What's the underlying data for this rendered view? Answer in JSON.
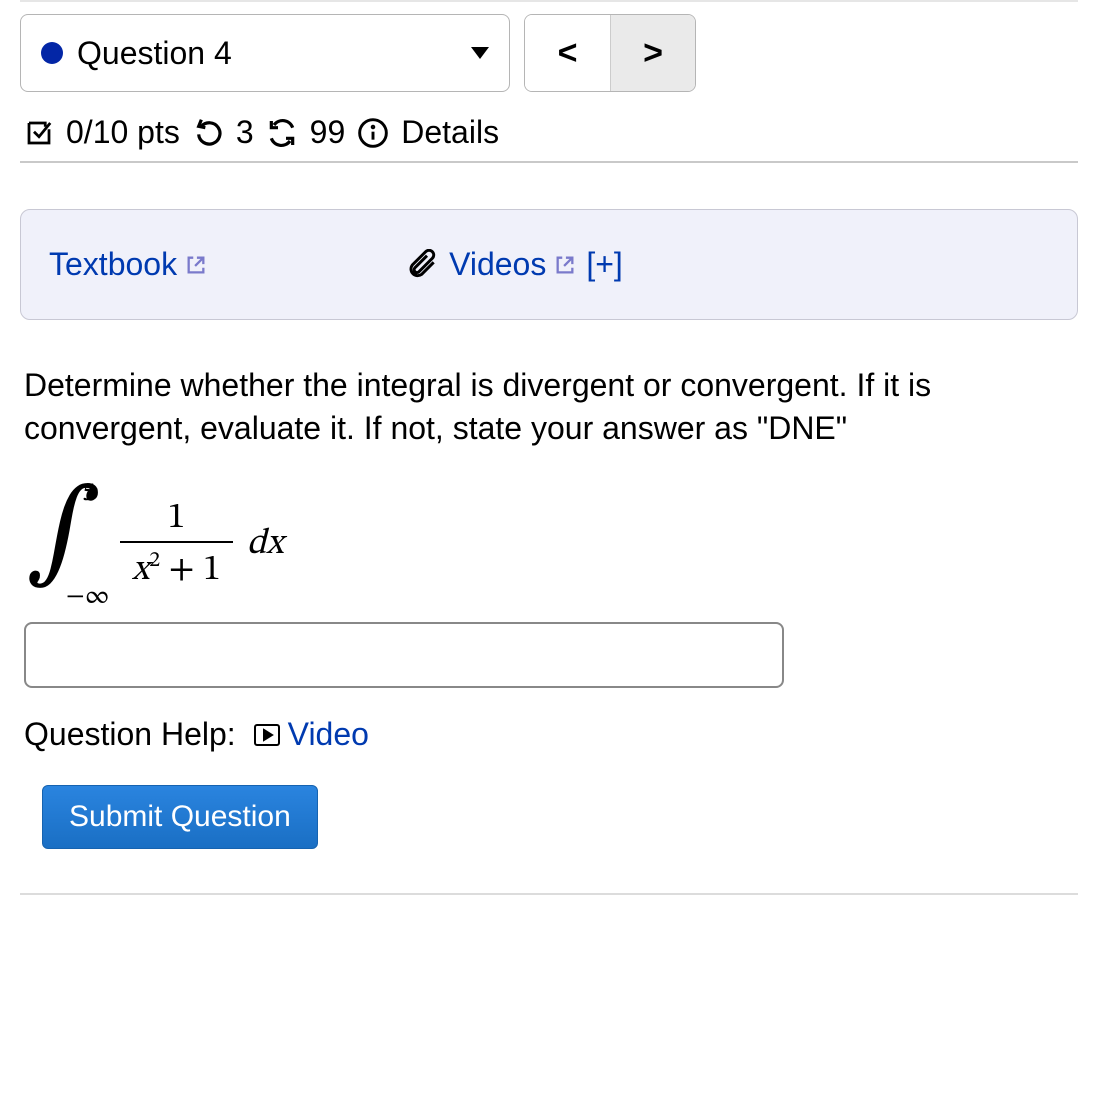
{
  "header": {
    "question_label": "Question 4",
    "prev_glyph": "<",
    "next_glyph": ">"
  },
  "stats": {
    "points": "0/10 pts",
    "attempts_used": "3",
    "attempts_total": "99",
    "details_label": "Details"
  },
  "resources": {
    "textbook_label": "Textbook",
    "videos_label": "Videos",
    "expand_label": "[+]"
  },
  "question": {
    "prompt": "Determine whether the integral is divergent or convergent. If it is convergent, evaluate it. If not, state your answer as \"DNE\"",
    "integral": {
      "upper": "5",
      "lower": "−∞",
      "numerator": "1",
      "denominator_base": "x",
      "denominator_exp": "2",
      "denominator_tail": " + 1",
      "differential": "dx"
    },
    "answer_value": ""
  },
  "help": {
    "label": "Question Help:",
    "video_label": "Video"
  },
  "actions": {
    "submit_label": "Submit Question"
  }
}
